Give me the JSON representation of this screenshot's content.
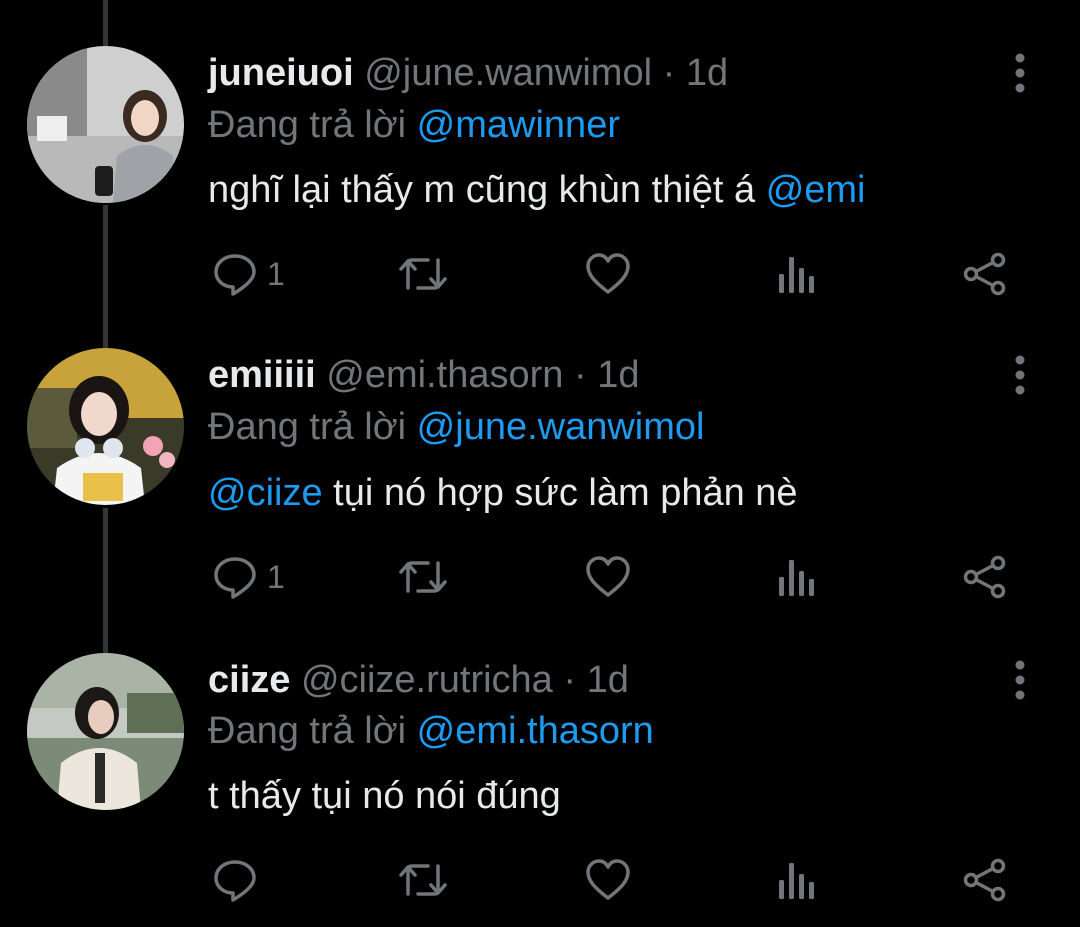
{
  "colors": {
    "background": "#000000",
    "primary_text": "#e7e9ea",
    "secondary_text": "#71767b",
    "accent": "#1d9bf0",
    "thread_line": "#333639"
  },
  "icons": [
    "more-vertical-icon",
    "reply-icon",
    "retweet-icon",
    "like-icon",
    "views-icon",
    "share-icon"
  ],
  "tweets": [
    {
      "display_name": "juneiuoi",
      "handle": "@june.wanwimol",
      "separator": "·",
      "time": "1d",
      "replying_label": "Đang trả lời",
      "replying_to": "@mawinner",
      "body_text": "nghĩ lại thấy m cũng khùn thiệt á",
      "body_mention": "@emi",
      "reply_count": "1"
    },
    {
      "display_name": "emiiiii",
      "handle": "@emi.thasorn",
      "separator": "·",
      "time": "1d",
      "replying_label": "Đang trả lời",
      "replying_to": "@june.wanwimol",
      "body_mention": "@ciize",
      "body_text": "tụi nó hợp sức làm phản nè",
      "reply_count": "1"
    },
    {
      "display_name": "ciize",
      "handle": "@ciize.rutricha",
      "separator": "·",
      "time": "1d",
      "replying_label": "Đang trả lời",
      "replying_to": "@emi.thasorn",
      "body_text": "t thấy tụi nó nói đúng",
      "reply_count": ""
    }
  ]
}
